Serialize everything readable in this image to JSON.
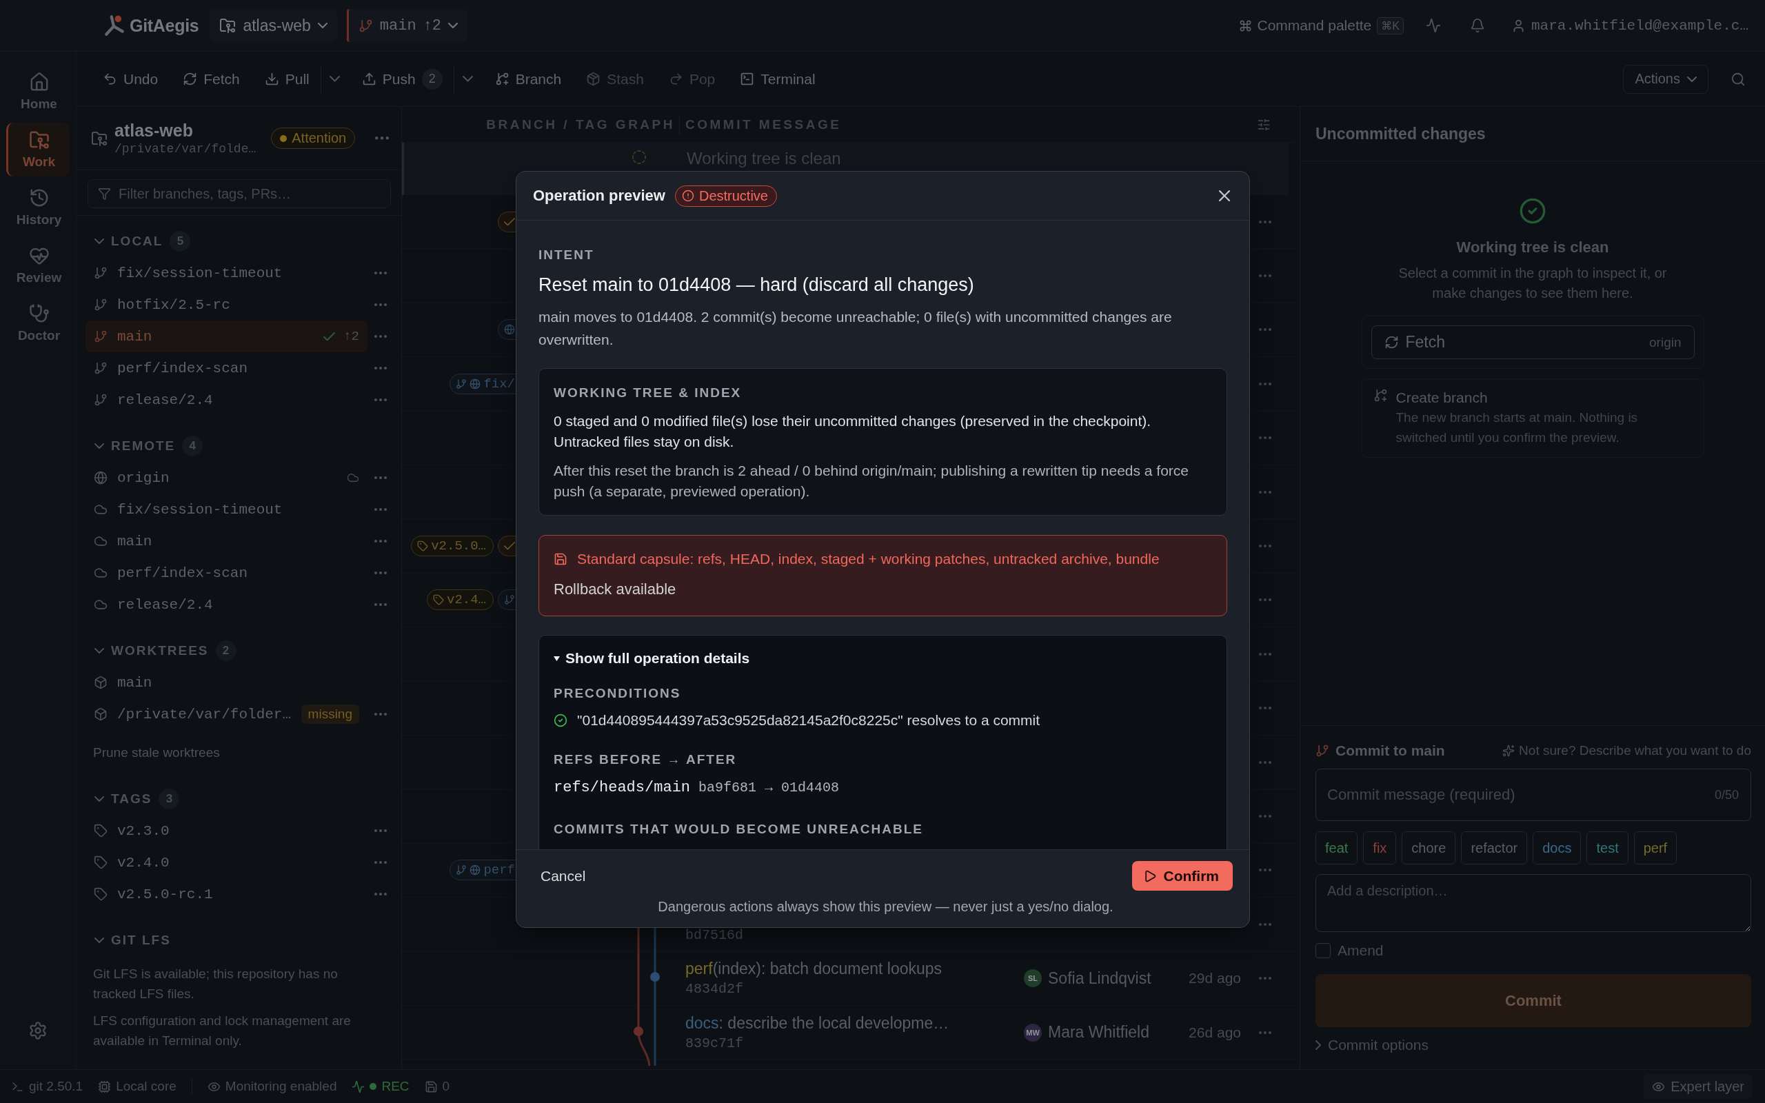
{
  "topbar": {
    "logo": "GitAegis",
    "repo": "atlas-web",
    "branch": "main",
    "ahead": "↑2",
    "command_palette": "Command palette",
    "shortcut": "⌘K",
    "user": "mara.whitfield@example.c…"
  },
  "nav": {
    "items": [
      {
        "label": "Home",
        "selected": false
      },
      {
        "label": "Work",
        "selected": true
      },
      {
        "label": "History",
        "selected": false
      },
      {
        "label": "Review",
        "selected": false
      },
      {
        "label": "Doctor",
        "selected": false
      }
    ]
  },
  "toolbar": {
    "buttons": [
      {
        "label": "Undo",
        "disabled": false
      },
      {
        "label": "Fetch",
        "disabled": false
      },
      {
        "label": "Pull",
        "disabled": false,
        "dropdown": true
      },
      {
        "label": "Push",
        "count": "2",
        "disabled": false,
        "dropdown": true
      },
      {
        "label": "Branch",
        "disabled": false
      },
      {
        "label": "Stash",
        "disabled": true
      },
      {
        "label": "Pop",
        "disabled": true
      },
      {
        "label": "Terminal",
        "disabled": false
      }
    ],
    "actions": "Actions"
  },
  "sidebar": {
    "repo": {
      "name": "atlas-web",
      "path": "/private/var/folde…",
      "status": "Attention"
    },
    "filter": {
      "placeholder": "Filter branches, tags, PRs…"
    },
    "sections": [
      {
        "title": "LOCAL",
        "count": "5",
        "expanded": true,
        "items": [
          {
            "kind": "branch",
            "label": "fix/session-timeout",
            "selected": false,
            "current": false,
            "menu": true
          },
          {
            "kind": "branch",
            "label": "hotfix/2.5-rc",
            "selected": false,
            "current": false,
            "menu": true
          },
          {
            "kind": "branch",
            "label": "main",
            "selected": true,
            "current": true,
            "ahead": "↑2",
            "menu": true
          },
          {
            "kind": "branch",
            "label": "perf/index-scan",
            "selected": false,
            "current": false,
            "menu": true
          },
          {
            "kind": "branch",
            "label": "release/2.4",
            "selected": false,
            "current": false,
            "menu": true
          }
        ]
      },
      {
        "title": "REMOTE",
        "count": "4",
        "expanded": true,
        "items": [
          {
            "kind": "remote",
            "label": "origin",
            "selected": false,
            "menu": true
          },
          {
            "kind": "remote-branch",
            "label": "fix/session-timeout",
            "selected": false,
            "menu": true
          },
          {
            "kind": "remote-branch",
            "label": "main",
            "selected": false,
            "menu": true
          },
          {
            "kind": "remote-branch",
            "label": "perf/index-scan",
            "selected": false,
            "menu": true
          },
          {
            "kind": "remote-branch",
            "label": "release/2.4",
            "selected": false,
            "menu": true
          }
        ]
      },
      {
        "title": "WORKTREES",
        "count": "2",
        "expanded": true,
        "items": [
          {
            "kind": "worktree",
            "label": "main",
            "selected": false,
            "menu": false
          },
          {
            "kind": "worktree",
            "label": "/private/var/folder…",
            "badge": "missing",
            "selected": false,
            "menu": true
          }
        ],
        "link": "Prune stale worktrees"
      },
      {
        "title": "TAGS",
        "count": "3",
        "expanded": true,
        "items": [
          {
            "kind": "tag",
            "label": "v2.3.0",
            "selected": false,
            "menu": true
          },
          {
            "kind": "tag",
            "label": "v2.4.0",
            "selected": false,
            "menu": true
          },
          {
            "kind": "tag",
            "label": "v2.5.0-rc.1",
            "selected": false,
            "menu": true
          }
        ]
      },
      {
        "title": "GIT LFS",
        "expanded": true,
        "notes": [
          "Git LFS is available; this repository has no tracked LFS files.",
          "LFS configuration and lock management are available in Terminal only."
        ]
      }
    ]
  },
  "graph": {
    "columns": [
      "BRANCH / TAG GRAPH",
      "COMMIT MESSAGE"
    ],
    "working_tree": "Working tree is clean",
    "rows": [
      {
        "kind": "covered",
        "refs": [
          {
            "kind": "head"
          }
        ]
      },
      {
        "kind": "covered"
      },
      {
        "kind": "covered",
        "refs": [
          {
            "kind": "remote"
          }
        ]
      },
      {
        "kind": "covered",
        "refs": [
          {
            "kind": "branch",
            "label": "fix/"
          }
        ]
      },
      {
        "kind": "covered"
      },
      {
        "kind": "covered"
      },
      {
        "kind": "covered",
        "refs": [
          {
            "kind": "tag",
            "label": "v2.5.0…"
          },
          {
            "kind": "head"
          }
        ]
      },
      {
        "kind": "covered",
        "refs": [
          {
            "kind": "tag",
            "label": "v2.4…"
          },
          {
            "kind": "local"
          }
        ]
      },
      {
        "kind": "covered"
      },
      {
        "kind": "covered"
      },
      {
        "kind": "covered"
      },
      {
        "kind": "covered"
      },
      {
        "kind": "covered",
        "refs": [
          {
            "kind": "branch",
            "label": "perf"
          }
        ]
      },
      {
        "kind": "hash",
        "hash": "bd7516d"
      },
      {
        "kind": "commit",
        "message": {
          "type": "perf",
          "color": "#7a6a2a",
          "rest": "(index): batch document lookups"
        },
        "author": {
          "initials": "SL",
          "name": "Sofia Lindqvist",
          "color": "#1f3d28"
        },
        "time": "29d ago",
        "hash": "4834d2f"
      },
      {
        "kind": "commit",
        "message": {
          "type": "docs",
          "color": "#3a5f80",
          "rest": ": describe the local developme…"
        },
        "author": {
          "initials": "MW",
          "name": "Mara Whitfield",
          "color": "#2e2540"
        },
        "time": "26d ago",
        "hash": "839c71f"
      }
    ]
  },
  "inspector": {
    "title": "Uncommitted changes",
    "empty_title": "Working tree is clean",
    "empty_text": "Select a commit in the graph to inspect it, or make changes to see them here.",
    "fetch": {
      "label": "Fetch",
      "remote": "origin"
    },
    "create_branch": {
      "title": "Create branch",
      "text": "The new branch starts at main. Nothing is switched until you confirm the preview."
    }
  },
  "commit": {
    "title": "Commit to main",
    "assist": "Not sure? Describe what you want to do",
    "message": {
      "placeholder": "Commit message (required)",
      "counter": "0/50"
    },
    "types": [
      {
        "label": "feat",
        "color": "#3a7a48"
      },
      {
        "label": "fix",
        "color": "#8a4038"
      },
      {
        "label": "chore",
        "color": "#5a5e65"
      },
      {
        "label": "refactor",
        "color": "#5a5e65"
      },
      {
        "label": "docs",
        "color": "#3a6a8a"
      },
      {
        "label": "test",
        "color": "#317878"
      },
      {
        "label": "perf",
        "color": "#7a6a2a"
      }
    ],
    "description": {
      "placeholder": "Add a description…"
    },
    "amend": {
      "label": "Amend",
      "checked": false
    },
    "submit": {
      "label": "Commit",
      "disabled": true
    },
    "options": {
      "label": "Commit options",
      "expanded": false
    }
  },
  "dialog": {
    "title": "Operation preview",
    "badge": "Destructive",
    "intent_label": "INTENT",
    "intent": "Reset main to 01d4408 — hard (discard all changes)",
    "summary": "main moves to 01d4408. 2 commit(s) become unreachable; 0 file(s) with uncommitted changes are overwritten.",
    "working_tree": {
      "label": "WORKING TREE & INDEX",
      "effect": "0 staged and 0 modified file(s) lose their uncommitted changes (preserved in the checkpoint). Untracked files stay on disk.",
      "note": "After this reset the branch is 2 ahead / 0 behind origin/main; publishing a rewritten tip needs a force push (a separate, previewed operation)."
    },
    "checkpoint": {
      "text": "Standard capsule: refs, HEAD, index, staged + working patches, untracked archive, bundle",
      "status": "Rollback available"
    },
    "details": {
      "summary": "Show full operation details",
      "expanded": true,
      "preconditions_label": "PRECONDITIONS",
      "preconditions": [
        {
          "text": "\"01d440895444397a53c9525da82145a2f0c8225c\" resolves to a commit",
          "ok": true
        }
      ],
      "refs_label": "REFS BEFORE → AFTER",
      "refs": [
        {
          "ref": "refs/heads/main",
          "change": "ba9f681 → 01d4408"
        }
      ],
      "unreachable_label": "COMMITS THAT WOULD BECOME UNREACHABLE"
    },
    "cancel": "Cancel",
    "confirm": "Confirm",
    "note": "Dangerous actions always show this preview — never just a yes/no dialog."
  },
  "status": {
    "items": [
      {
        "kind": "git",
        "label": "git 2.50.1"
      },
      {
        "kind": "core",
        "label": "Local core"
      },
      {
        "kind": "monitoring",
        "label": "Monitoring enabled"
      },
      {
        "kind": "recording",
        "label": "REC"
      },
      {
        "kind": "checkpoints",
        "label": "0"
      }
    ],
    "expert": "Expert layer"
  }
}
